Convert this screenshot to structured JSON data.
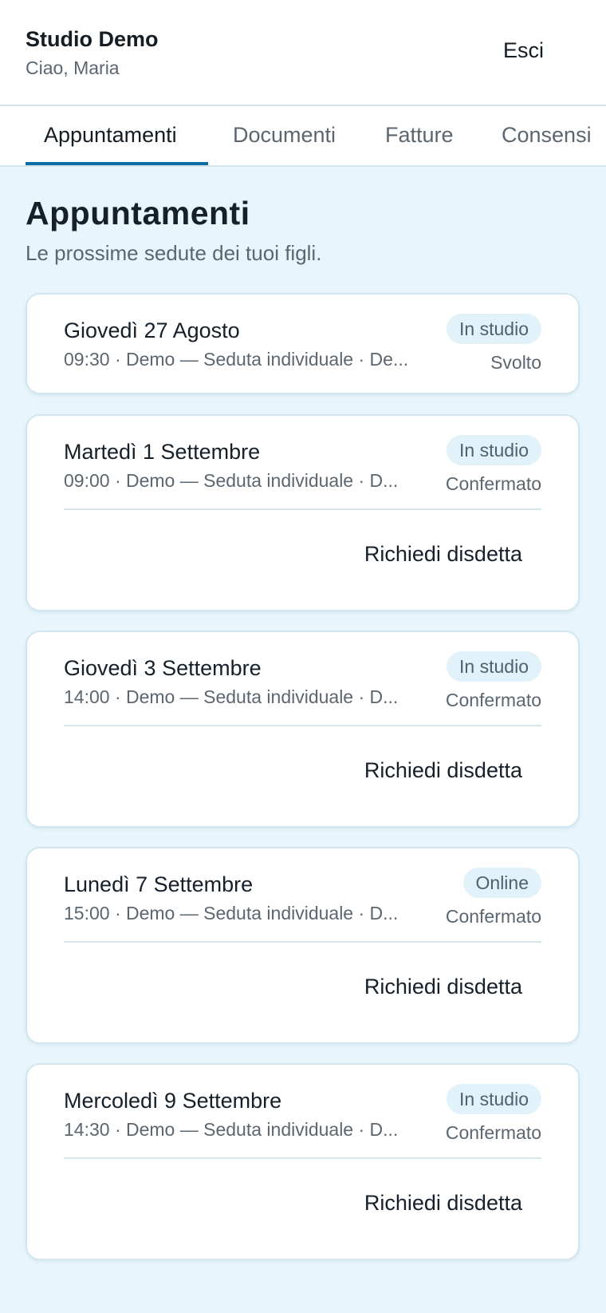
{
  "header": {
    "title": "Studio Demo",
    "greeting": "Ciao, Maria",
    "logout_label": "Esci"
  },
  "tabs": [
    {
      "label": "Appuntamenti",
      "active": true
    },
    {
      "label": "Documenti",
      "active": false
    },
    {
      "label": "Fatture",
      "active": false
    },
    {
      "label": "Consensi",
      "active": false
    }
  ],
  "main": {
    "title": "Appuntamenti",
    "subtitle": "Le prossime sedute dei tuoi figli."
  },
  "appointments": [
    {
      "date": "Giovedì 27 Agosto",
      "details": "09:30 · Demo — Seduta individuale · De...",
      "mode": "In studio",
      "status": "Svolto",
      "action": null
    },
    {
      "date": "Martedì 1 Settembre",
      "details": "09:00 · Demo — Seduta individuale · D...",
      "mode": "In studio",
      "status": "Confermato",
      "action": "Richiedi disdetta"
    },
    {
      "date": "Giovedì 3 Settembre",
      "details": "14:00 · Demo — Seduta individuale · D...",
      "mode": "In studio",
      "status": "Confermato",
      "action": "Richiedi disdetta"
    },
    {
      "date": "Lunedì 7 Settembre",
      "details": "15:00 · Demo — Seduta individuale · D...",
      "mode": "Online",
      "status": "Confermato",
      "action": "Richiedi disdetta"
    },
    {
      "date": "Mercoledì 9 Settembre",
      "details": "14:30 · Demo — Seduta individuale · D...",
      "mode": "In studio",
      "status": "Confermato",
      "action": "Richiedi disdetta"
    }
  ],
  "colors": {
    "accent": "#0a6fa3",
    "background": "#e8f6fc",
    "badge_bg": "#e2f2fa"
  }
}
